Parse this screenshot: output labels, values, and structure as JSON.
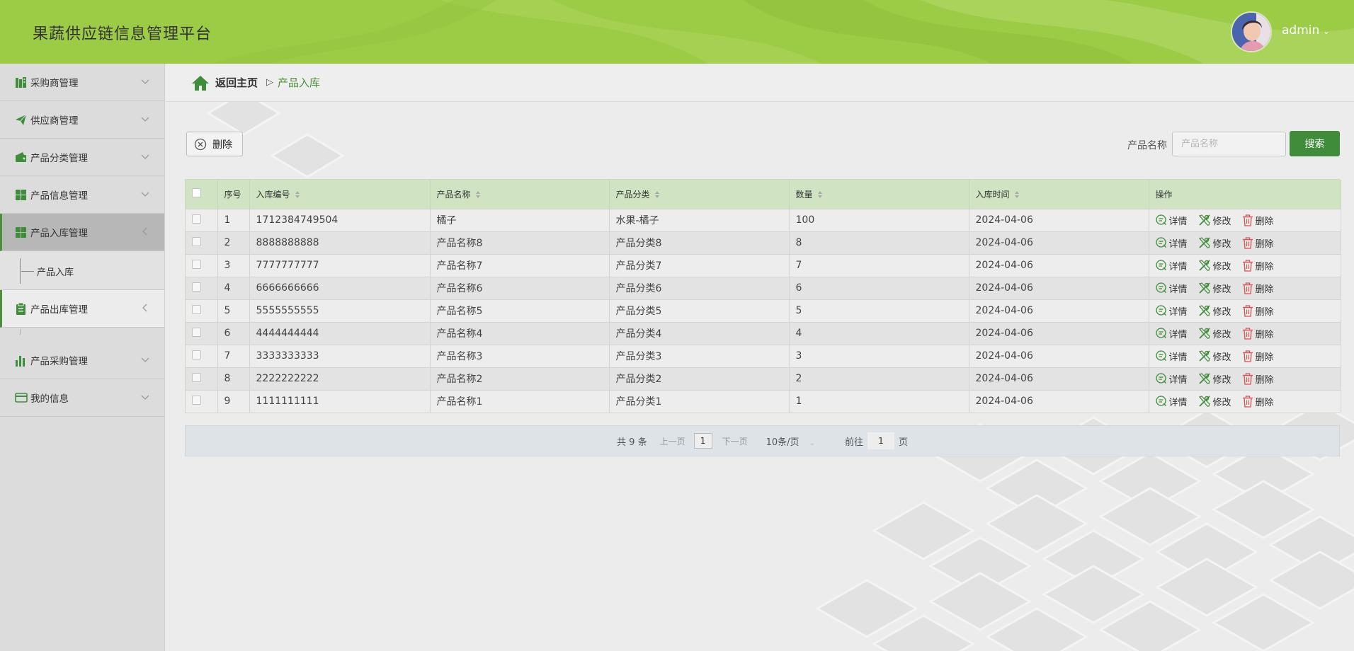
{
  "header": {
    "title": "果蔬供应链信息管理平台",
    "username": "admin",
    "bg_color": "#9ccb46"
  },
  "sidebar": {
    "items": [
      {
        "label": "采购商管理",
        "icon": "buildings-icon",
        "state": "collapsed"
      },
      {
        "label": "供应商管理",
        "icon": "paper-plane-icon",
        "state": "collapsed"
      },
      {
        "label": "产品分类管理",
        "icon": "wallet-icon",
        "state": "collapsed"
      },
      {
        "label": "产品信息管理",
        "icon": "grid-icon",
        "state": "collapsed"
      },
      {
        "label": "产品入库管理",
        "icon": "grid-icon",
        "state": "active",
        "submenu": [
          "产品入库"
        ]
      },
      {
        "label": "产品出库管理",
        "icon": "clipboard-icon",
        "state": "open"
      },
      {
        "label": "产品采购管理",
        "icon": "bar-chart-icon",
        "state": "collapsed"
      },
      {
        "label": "我的信息",
        "icon": "card-icon",
        "state": "collapsed"
      }
    ]
  },
  "breadcrumb": {
    "home": "返回主页",
    "separator": "▷",
    "current": "产品入库"
  },
  "toolbar": {
    "delete_label": "删除",
    "search_label": "产品名称",
    "search_placeholder": "产品名称",
    "search_button": "搜索"
  },
  "table": {
    "headers": [
      "序号",
      "入库编号",
      "产品名称",
      "产品分类",
      "数量",
      "入库时间",
      "操作"
    ],
    "rows": [
      {
        "idx": "1",
        "code": "1712384749504",
        "name": "橘子",
        "category": "水果-橘子",
        "qty": "100",
        "date": "2024-04-06"
      },
      {
        "idx": "2",
        "code": "8888888888",
        "name": "产品名称8",
        "category": "产品分类8",
        "qty": "8",
        "date": "2024-04-06"
      },
      {
        "idx": "3",
        "code": "7777777777",
        "name": "产品名称7",
        "category": "产品分类7",
        "qty": "7",
        "date": "2024-04-06"
      },
      {
        "idx": "4",
        "code": "6666666666",
        "name": "产品名称6",
        "category": "产品分类6",
        "qty": "6",
        "date": "2024-04-06"
      },
      {
        "idx": "5",
        "code": "5555555555",
        "name": "产品名称5",
        "category": "产品分类5",
        "qty": "5",
        "date": "2024-04-06"
      },
      {
        "idx": "6",
        "code": "4444444444",
        "name": "产品名称4",
        "category": "产品分类4",
        "qty": "4",
        "date": "2024-04-06"
      },
      {
        "idx": "7",
        "code": "3333333333",
        "name": "产品名称3",
        "category": "产品分类3",
        "qty": "3",
        "date": "2024-04-06"
      },
      {
        "idx": "8",
        "code": "2222222222",
        "name": "产品名称2",
        "category": "产品分类2",
        "qty": "2",
        "date": "2024-04-06"
      },
      {
        "idx": "9",
        "code": "1111111111",
        "name": "产品名称1",
        "category": "产品分类1",
        "qty": "1",
        "date": "2024-04-06"
      }
    ],
    "actions": {
      "detail": "详情",
      "edit": "修改",
      "delete": "删除"
    }
  },
  "pagination": {
    "total": "共 9 条",
    "prev": "上一页",
    "page": "1",
    "next": "下一页",
    "page_size": "10条/页",
    "goto": "前往",
    "goto_value": "1",
    "page_unit": "页"
  },
  "colors": {
    "accent": "#3f8d3a",
    "table_header": "#d0e4c4",
    "delete_red": "#d9534f"
  }
}
